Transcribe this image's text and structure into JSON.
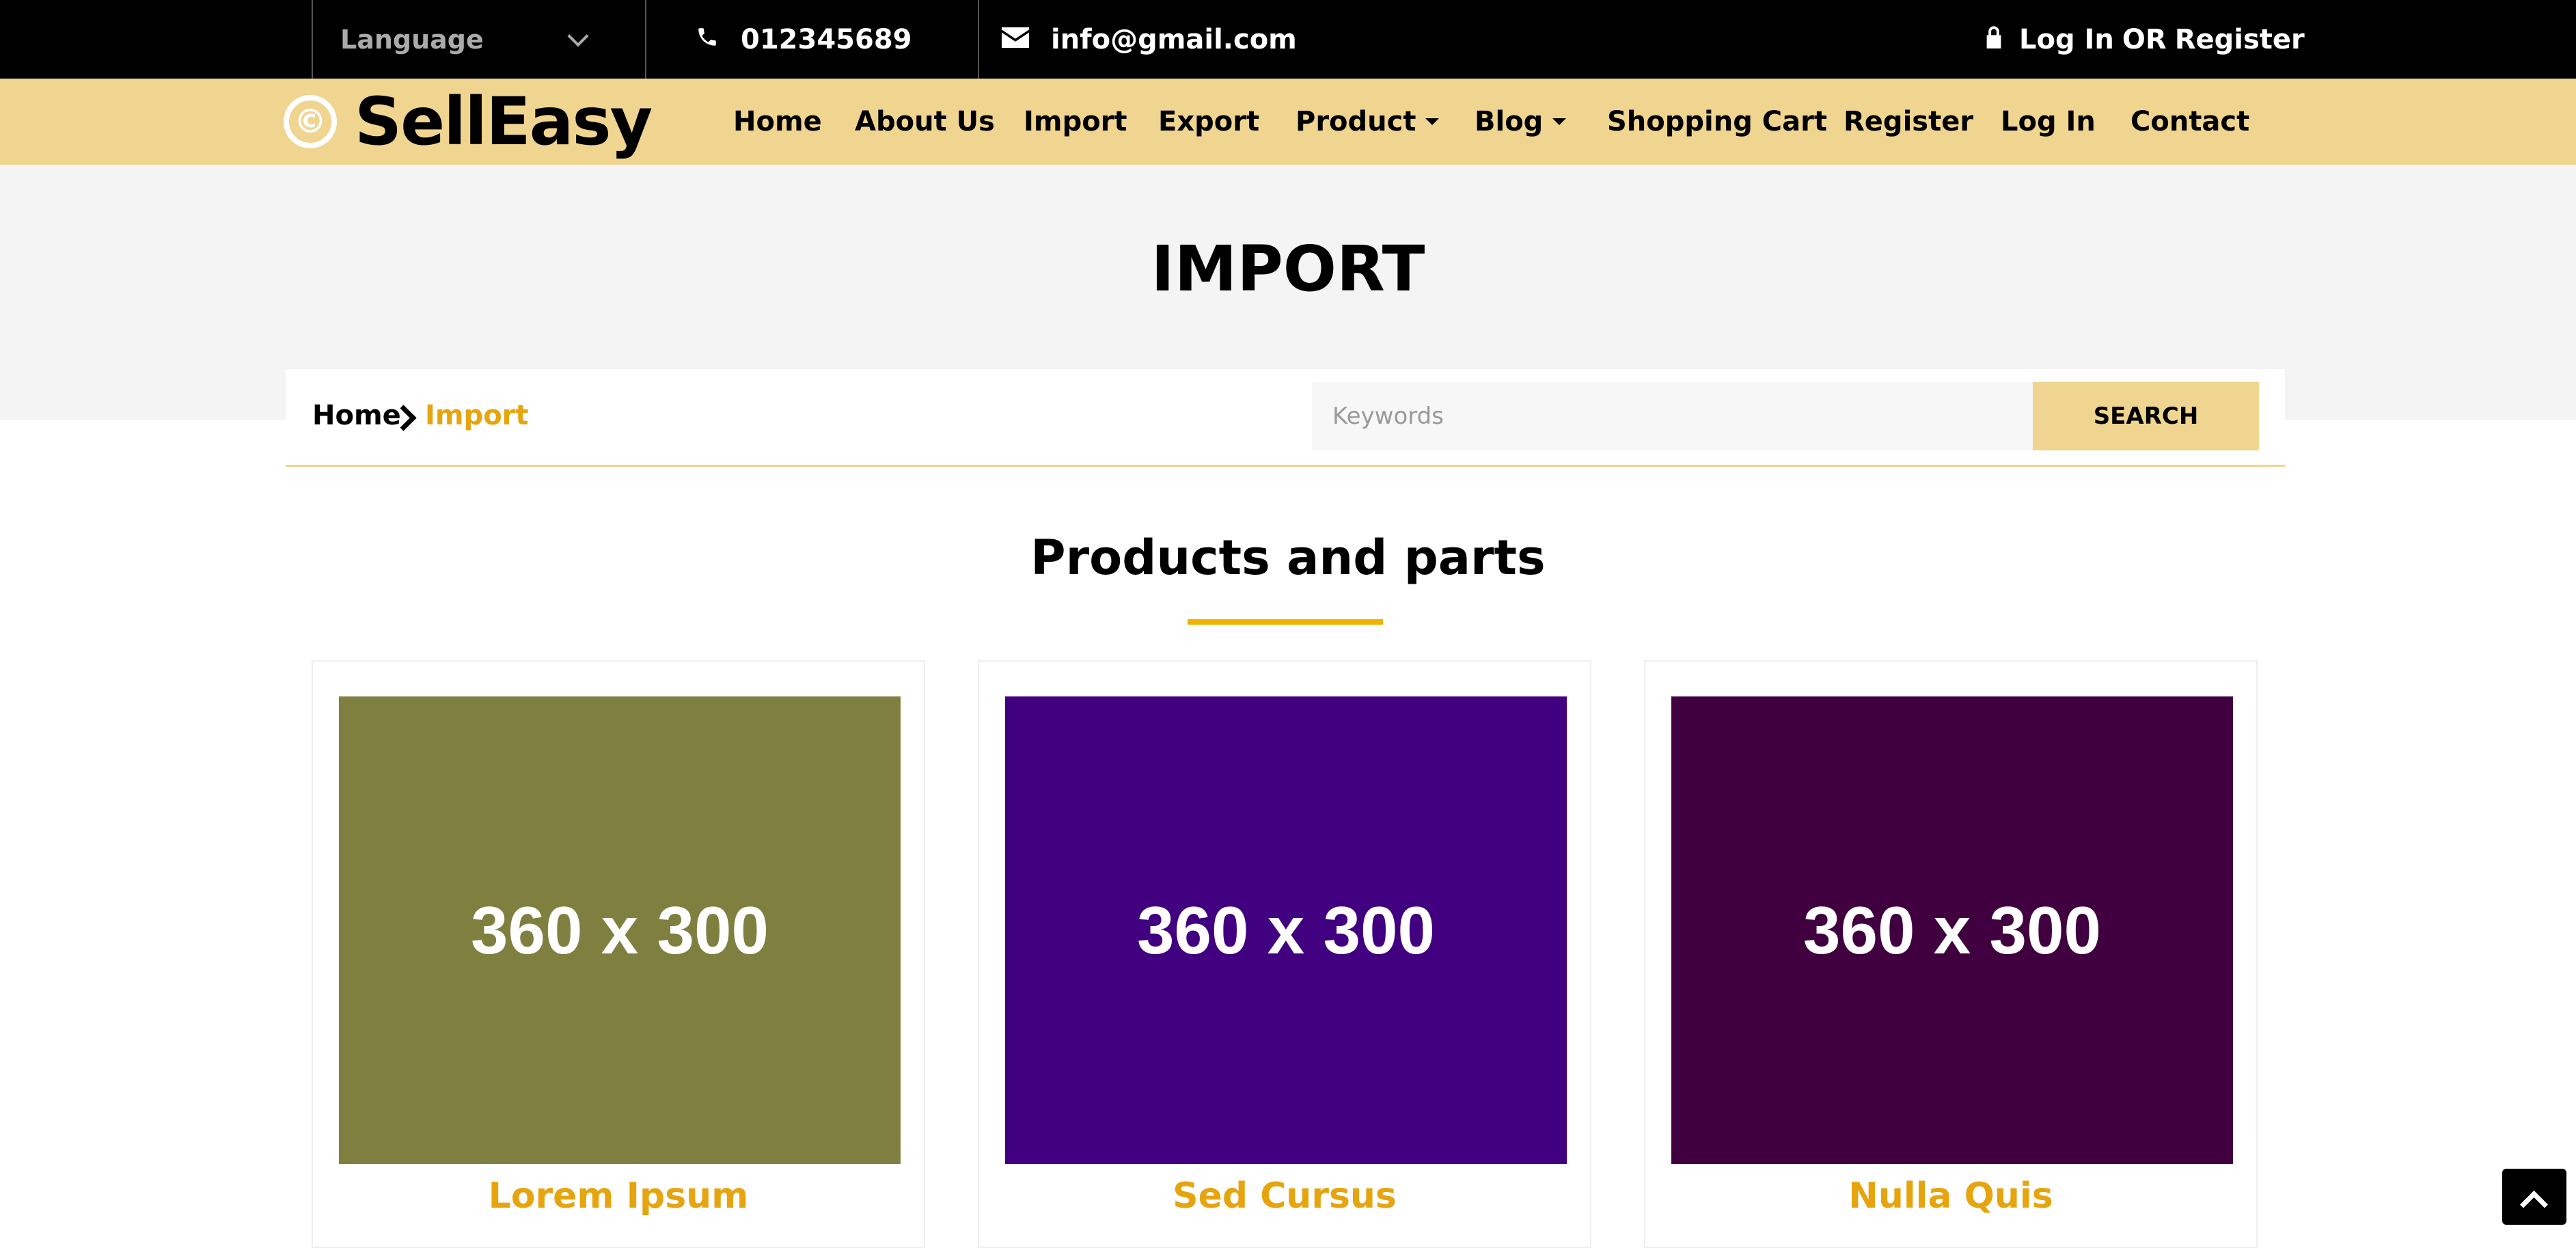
{
  "topbar": {
    "language_label": "Language",
    "phone": "012345689",
    "email": "info@gmail.com",
    "login_text": "Log In",
    "or_text": "OR",
    "register_text": "Register"
  },
  "logo": {
    "symbol": "©",
    "text": "SellEasy"
  },
  "nav": {
    "items": [
      {
        "label": "Home"
      },
      {
        "label": "About Us"
      },
      {
        "label": "Import"
      },
      {
        "label": "Export"
      },
      {
        "label": "Product"
      },
      {
        "label": "Blog"
      },
      {
        "label": "Shopping Cart"
      },
      {
        "label": "Register"
      },
      {
        "label": "Log In"
      },
      {
        "label": "Contact"
      }
    ]
  },
  "page": {
    "title": "IMPORT"
  },
  "breadcrumb": {
    "home": "Home",
    "current": "Import"
  },
  "search": {
    "placeholder": "Keywords",
    "button_label": "SEARCH"
  },
  "section": {
    "title": "Products and parts"
  },
  "products": [
    {
      "image_text": "360 x 300",
      "title": "Lorem Ipsum",
      "color": "#7f7f40"
    },
    {
      "image_text": "360 x 300",
      "title": "Sed Cursus",
      "color": "#400080"
    },
    {
      "image_text": "360 x 300",
      "title": "Nulla Quis",
      "color": "#400040"
    }
  ],
  "colors": {
    "accent_yellow": "#f0d591",
    "accent_orange": "#e6a40e",
    "topbar_bg": "#000000"
  }
}
